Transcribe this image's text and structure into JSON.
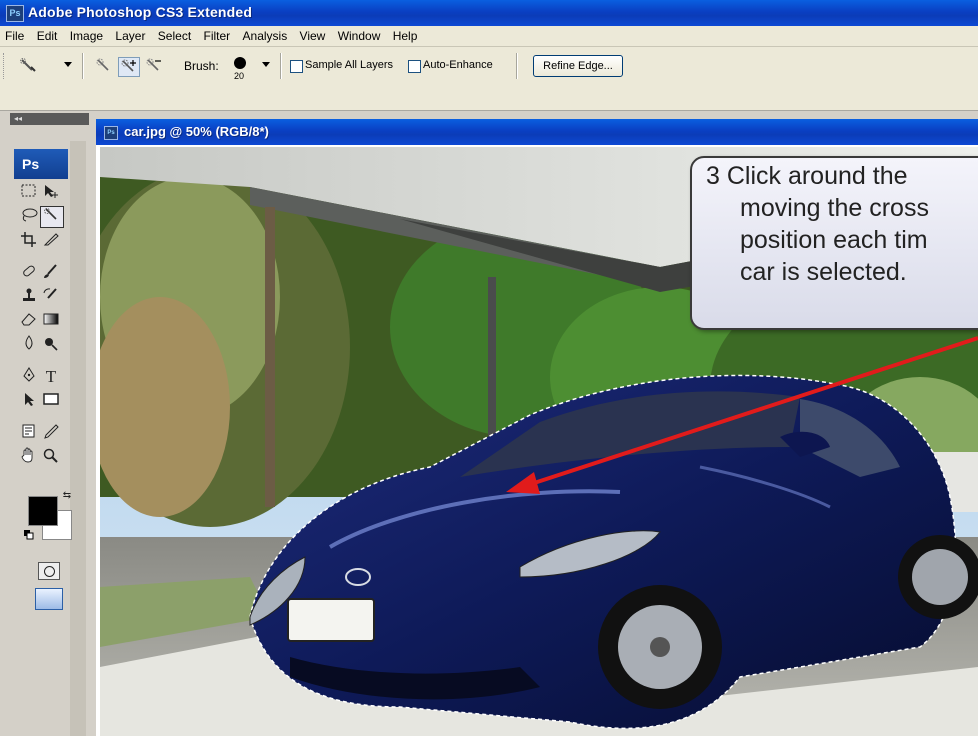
{
  "window": {
    "app_badge": "Ps",
    "title": "Adobe Photoshop CS3 Extended"
  },
  "menu": [
    "File",
    "Edit",
    "Image",
    "Layer",
    "Select",
    "Filter",
    "Analysis",
    "View",
    "Window",
    "Help"
  ],
  "options_bar": {
    "tool_icon": "quick-selection-icon",
    "mode_icons": [
      "new-selection-icon",
      "add-to-selection-icon",
      "subtract-from-selection-icon"
    ],
    "brush_label": "Brush:",
    "brush_size": "20",
    "sample_all_layers_label": "Sample All Layers",
    "sample_all_layers_checked": false,
    "auto_enhance_label": "Auto-Enhance",
    "auto_enhance_checked": false,
    "refine_edge_label": "Refine Edge..."
  },
  "toolbox": {
    "collapse_label": "◂◂",
    "logo": "Ps",
    "foreground_color": "#000000",
    "background_color": "#ffffff"
  },
  "document": {
    "badge": "Ps",
    "title": "car.jpg @ 50% (RGB/8*)"
  },
  "callout": {
    "lines": [
      "3  Click around the",
      "moving the cross",
      "position each tim",
      "car is selected."
    ]
  },
  "colors": {
    "titlebar": "#0b3fc4",
    "car": "#101a5e",
    "arrow": "#e11b1b"
  }
}
